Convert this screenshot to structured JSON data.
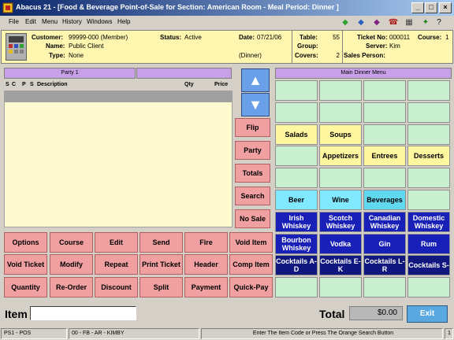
{
  "window": {
    "title": "Abacus 21 - [Food & Beverage Point-of-Sale for Section: American Room - Meal Period: Dinner ]"
  },
  "menubar": {
    "items": [
      "File",
      "Edit",
      "Menu",
      "History",
      "Windows",
      "Help"
    ]
  },
  "toolbar": {
    "icons": [
      "arrow-left-icon",
      "arrow-right-icon",
      "diamond-icon",
      "phone-icon",
      "calculator-icon",
      "run-icon",
      "help-icon"
    ]
  },
  "header": {
    "customer_label": "Customer:",
    "customer_value": "99999-000 (Member)",
    "name_label": "Name:",
    "name_value": "Public Client",
    "type_label": "Type:",
    "type_value": "None",
    "status_label": "Status:",
    "status_value": "Active",
    "date_label": "Date:",
    "date_value": "07/21/06",
    "meal_value": "(Dinner)",
    "table_label": "Table:",
    "table_value": "55",
    "group_label": "Group:",
    "group_value": "",
    "covers_label": "Covers:",
    "covers_value": "2",
    "ticket_label": "Ticket No:",
    "ticket_value": "000011",
    "course_label": "Course:",
    "course_value": "1",
    "server_label": "Server:",
    "server_value": "Kim",
    "salesperson_label": "Sales Person:",
    "salesperson_value": ""
  },
  "order": {
    "party_label": "Party 1",
    "columns": {
      "s": "S",
      "c": "C",
      "p": "P",
      "s2": "S",
      "description": "Description",
      "qty": "Qty",
      "price": "Price"
    }
  },
  "side_buttons": [
    "Flip",
    "Party",
    "Totals",
    "Search",
    "No Sale"
  ],
  "menu": {
    "title": "Main Dinner Menu",
    "cells": [
      [
        "",
        "",
        "",
        ""
      ],
      [
        "",
        "",
        "",
        ""
      ],
      [
        "Salads",
        "Soups",
        "",
        ""
      ],
      [
        "",
        "Appetizers",
        "Entrees",
        "Desserts"
      ],
      [
        "",
        "",
        "",
        ""
      ],
      [
        "Beer",
        "Wine",
        "Beverages",
        ""
      ],
      [
        "Irish Whiskey",
        "Scotch Whiskey",
        "Canadian Whiskey",
        "Domestic Whiskey"
      ],
      [
        "Bourbon Whiskey",
        "Vodka",
        "Gin",
        "Rum"
      ],
      [
        "Cocktails A-D",
        "Cocktails E-K",
        "Cocktails L-R",
        "Cocktails S-"
      ],
      [
        "",
        "",
        "",
        ""
      ]
    ],
    "colors": {
      "empty": "#c8f0d0",
      "food": "#fff6a0",
      "beer_wine": "#80e8ff",
      "beverages": "#60d8f0",
      "liquor": "#1820b8",
      "cocktails": "#101880"
    }
  },
  "actions": [
    [
      "Options",
      "Course",
      "Edit",
      "Send",
      "Fire",
      "Void Item"
    ],
    [
      "Void Ticket",
      "Modify",
      "Repeat",
      "Print Ticket",
      "Header",
      "Comp Item"
    ],
    [
      "Quantity",
      "Re-Order",
      "Discount",
      "Split",
      "Payment",
      "Quick-Pay"
    ]
  ],
  "bottom": {
    "item_label": "Item",
    "item_value": "",
    "total_label": "Total",
    "total_value": "$0.00",
    "exit_label": "Exit"
  },
  "status": {
    "terminal": "PS1 - POS",
    "session": "00 - FB - AR - KIMBY",
    "message": "Enter The Item Code or Press The Orange Search Button",
    "page": "1"
  }
}
